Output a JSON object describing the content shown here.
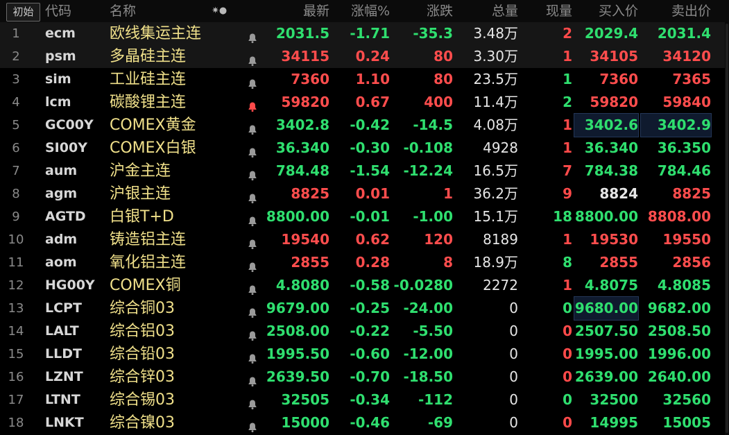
{
  "header": {
    "init_label": "初始",
    "cols": [
      "代码",
      "名称",
      "最新",
      "涨幅%",
      "涨跌",
      "总量",
      "现量",
      "买入价",
      "卖出价"
    ],
    "sort_glyph": "✷●"
  },
  "colors": {
    "up": "#ff4d4d",
    "down": "#2fdf6f",
    "flat": "#e6e6e6",
    "name": "#f0e08a",
    "bell_active": "#ff4a4a",
    "bell": "#9a9a9a"
  },
  "rows": [
    {
      "n": "1",
      "code": "ecm",
      "name": "欧线集运主连",
      "last": "2031.5",
      "pct": "-1.71",
      "chg": "-35.3",
      "vol": "3.48万",
      "cur": "2",
      "bid": "2029.4",
      "ask": "2031.4",
      "dir": "down",
      "bid_dir": "down",
      "ask_dir": "down",
      "cur_dir": "up",
      "hl": true,
      "bell": "gray"
    },
    {
      "n": "2",
      "code": "psm",
      "name": "多晶硅主连",
      "last": "34115",
      "pct": "0.24",
      "chg": "80",
      "vol": "3.30万",
      "cur": "1",
      "bid": "34105",
      "ask": "34120",
      "dir": "up",
      "bid_dir": "up",
      "ask_dir": "up",
      "cur_dir": "up",
      "hl": true,
      "bell": "gray"
    },
    {
      "n": "3",
      "code": "sim",
      "name": "工业硅主连",
      "last": "7360",
      "pct": "1.10",
      "chg": "80",
      "vol": "23.5万",
      "cur": "1",
      "bid": "7360",
      "ask": "7365",
      "dir": "up",
      "bid_dir": "up",
      "ask_dir": "up",
      "cur_dir": "down",
      "bell": "gray"
    },
    {
      "n": "4",
      "code": "lcm",
      "name": "碳酸锂主连",
      "last": "59820",
      "pct": "0.67",
      "chg": "400",
      "vol": "11.4万",
      "cur": "2",
      "bid": "59820",
      "ask": "59840",
      "dir": "up",
      "bid_dir": "up",
      "ask_dir": "up",
      "cur_dir": "down",
      "bell": "red"
    },
    {
      "n": "5",
      "code": "GC00Y",
      "name": "COMEX黄金",
      "last": "3402.8",
      "pct": "-0.42",
      "chg": "-14.5",
      "vol": "4.08万",
      "cur": "1",
      "bid": "3402.6",
      "ask": "3402.9",
      "dir": "down",
      "bid_dir": "down",
      "ask_dir": "down",
      "cur_dir": "up",
      "bell": "gray",
      "bid_box": true,
      "ask_box": true
    },
    {
      "n": "6",
      "code": "SI00Y",
      "name": "COMEX白银",
      "last": "36.340",
      "pct": "-0.30",
      "chg": "-0.108",
      "vol": "4928",
      "cur": "1",
      "bid": "36.340",
      "ask": "36.350",
      "dir": "down",
      "bid_dir": "down",
      "ask_dir": "down",
      "cur_dir": "up",
      "bell": "gray"
    },
    {
      "n": "7",
      "code": "aum",
      "name": "沪金主连",
      "last": "784.48",
      "pct": "-1.54",
      "chg": "-12.24",
      "vol": "16.5万",
      "cur": "7",
      "bid": "784.38",
      "ask": "784.46",
      "dir": "down",
      "bid_dir": "down",
      "ask_dir": "down",
      "cur_dir": "up",
      "bell": "gray"
    },
    {
      "n": "8",
      "code": "agm",
      "name": "沪银主连",
      "last": "8825",
      "pct": "0.01",
      "chg": "1",
      "vol": "36.2万",
      "cur": "9",
      "bid": "8824",
      "ask": "8825",
      "dir": "up",
      "bid_dir": "flat",
      "ask_dir": "up",
      "cur_dir": "up",
      "bell": "gray"
    },
    {
      "n": "9",
      "code": "AGTD",
      "name": "白银T+D",
      "last": "8800.00",
      "pct": "-0.01",
      "chg": "-1.00",
      "vol": "15.1万",
      "cur": "18",
      "bid": "8800.00",
      "ask": "8808.00",
      "dir": "down",
      "bid_dir": "down",
      "ask_dir": "up",
      "cur_dir": "down",
      "bell": "gray"
    },
    {
      "n": "10",
      "code": "adm",
      "name": "铸造铝主连",
      "last": "19540",
      "pct": "0.62",
      "chg": "120",
      "vol": "8189",
      "cur": "1",
      "bid": "19530",
      "ask": "19550",
      "dir": "up",
      "bid_dir": "up",
      "ask_dir": "up",
      "cur_dir": "up",
      "bell": "gray"
    },
    {
      "n": "11",
      "code": "aom",
      "name": "氧化铝主连",
      "last": "2855",
      "pct": "0.28",
      "chg": "8",
      "vol": "18.9万",
      "cur": "8",
      "bid": "2855",
      "ask": "2856",
      "dir": "up",
      "bid_dir": "up",
      "ask_dir": "up",
      "cur_dir": "down",
      "bell": "gray"
    },
    {
      "n": "12",
      "code": "HG00Y",
      "name": "COMEX铜",
      "last": "4.8080",
      "pct": "-0.58",
      "chg": "-0.0280",
      "vol": "2272",
      "cur": "1",
      "bid": "4.8075",
      "ask": "4.8085",
      "dir": "down",
      "bid_dir": "down",
      "ask_dir": "down",
      "cur_dir": "up",
      "bell": "gray"
    },
    {
      "n": "13",
      "code": "LCPT",
      "name": "综合铜03",
      "last": "9679.00",
      "pct": "-0.25",
      "chg": "-24.00",
      "vol": "0",
      "cur": "0",
      "bid": "9680.00",
      "ask": "9682.00",
      "dir": "down",
      "bid_dir": "down",
      "ask_dir": "down",
      "cur_dir": "down",
      "bell": "gray",
      "bid_box": true
    },
    {
      "n": "14",
      "code": "LALT",
      "name": "综合铝03",
      "last": "2508.00",
      "pct": "-0.22",
      "chg": "-5.50",
      "vol": "0",
      "cur": "0",
      "bid": "2507.50",
      "ask": "2508.50",
      "dir": "down",
      "bid_dir": "down",
      "ask_dir": "down",
      "cur_dir": "up",
      "bell": "gray"
    },
    {
      "n": "15",
      "code": "LLDT",
      "name": "综合铅03",
      "last": "1995.50",
      "pct": "-0.60",
      "chg": "-12.00",
      "vol": "0",
      "cur": "0",
      "bid": "1995.00",
      "ask": "1996.00",
      "dir": "down",
      "bid_dir": "down",
      "ask_dir": "down",
      "cur_dir": "up",
      "bell": "gray"
    },
    {
      "n": "16",
      "code": "LZNT",
      "name": "综合锌03",
      "last": "2639.50",
      "pct": "-0.70",
      "chg": "-18.50",
      "vol": "0",
      "cur": "0",
      "bid": "2639.00",
      "ask": "2640.00",
      "dir": "down",
      "bid_dir": "down",
      "ask_dir": "down",
      "cur_dir": "up",
      "bell": "gray"
    },
    {
      "n": "17",
      "code": "LTNT",
      "name": "综合锡03",
      "last": "32505",
      "pct": "-0.34",
      "chg": "-112",
      "vol": "0",
      "cur": "0",
      "bid": "32500",
      "ask": "32560",
      "dir": "down",
      "bid_dir": "down",
      "ask_dir": "down",
      "cur_dir": "down",
      "bell": "gray"
    },
    {
      "n": "18",
      "code": "LNKT",
      "name": "综合镍03",
      "last": "15000",
      "pct": "-0.46",
      "chg": "-69",
      "vol": "0",
      "cur": "0",
      "bid": "14995",
      "ask": "15005",
      "dir": "down",
      "bid_dir": "down",
      "ask_dir": "down",
      "cur_dir": "up",
      "bell": "gray"
    }
  ]
}
